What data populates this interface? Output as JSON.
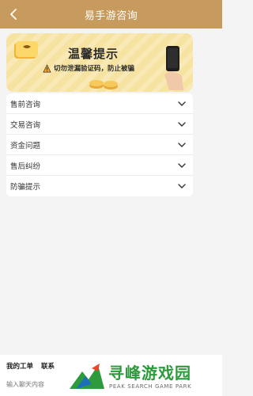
{
  "header": {
    "title": "易手游咨询"
  },
  "banner": {
    "title": "温馨提示",
    "text": "切勿泄漏验证码，防止被骗",
    "carousel": {
      "count": 2,
      "active": 0
    }
  },
  "menu": {
    "items": [
      {
        "label": "售前咨询"
      },
      {
        "label": "交易咨询"
      },
      {
        "label": "资金问题"
      },
      {
        "label": "售后纠纷"
      },
      {
        "label": "防骗提示"
      }
    ]
  },
  "bottom": {
    "tabs": [
      {
        "label": "我的工单"
      },
      {
        "label": "联系"
      }
    ],
    "input_placeholder": "输入聊天内容"
  },
  "watermark": {
    "title": "寻峰游戏园",
    "subtitle": "PEAK SEARCH GAME PARK"
  },
  "colors": {
    "header": "#c79a5e",
    "banner": "#f7e3a1",
    "watermark": "#2d9a3b"
  }
}
